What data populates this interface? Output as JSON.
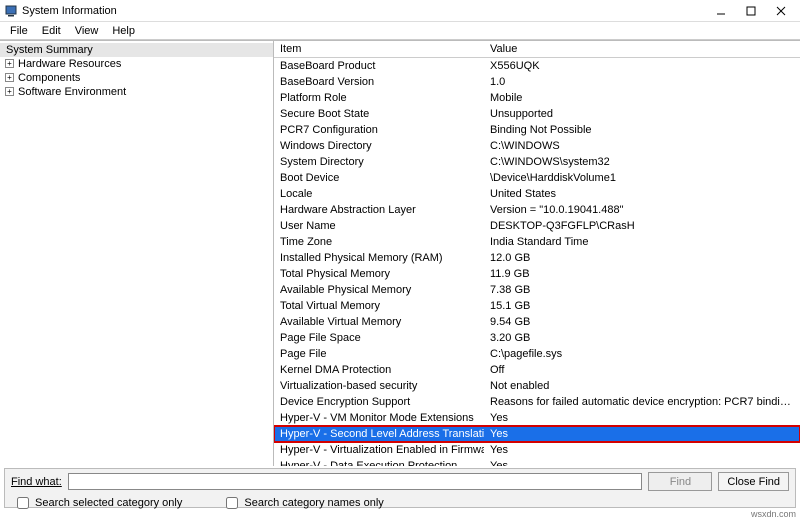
{
  "window": {
    "title": "System Information",
    "menu": [
      "File",
      "Edit",
      "View",
      "Help"
    ]
  },
  "tree": {
    "root": "System Summary",
    "children": [
      "Hardware Resources",
      "Components",
      "Software Environment"
    ]
  },
  "list": {
    "headers": {
      "item": "Item",
      "value": "Value"
    },
    "rows": [
      {
        "item": "BaseBoard Product",
        "value": "X556UQK"
      },
      {
        "item": "BaseBoard Version",
        "value": "1.0"
      },
      {
        "item": "Platform Role",
        "value": "Mobile"
      },
      {
        "item": "Secure Boot State",
        "value": "Unsupported"
      },
      {
        "item": "PCR7 Configuration",
        "value": "Binding Not Possible"
      },
      {
        "item": "Windows Directory",
        "value": "C:\\WINDOWS"
      },
      {
        "item": "System Directory",
        "value": "C:\\WINDOWS\\system32"
      },
      {
        "item": "Boot Device",
        "value": "\\Device\\HarddiskVolume1"
      },
      {
        "item": "Locale",
        "value": "United States"
      },
      {
        "item": "Hardware Abstraction Layer",
        "value": "Version = \"10.0.19041.488\""
      },
      {
        "item": "User Name",
        "value": "DESKTOP-Q3FGFLP\\CRasH"
      },
      {
        "item": "Time Zone",
        "value": "India Standard Time"
      },
      {
        "item": "Installed Physical Memory (RAM)",
        "value": "12.0 GB"
      },
      {
        "item": "Total Physical Memory",
        "value": "11.9 GB"
      },
      {
        "item": "Available Physical Memory",
        "value": "7.38 GB"
      },
      {
        "item": "Total Virtual Memory",
        "value": "15.1 GB"
      },
      {
        "item": "Available Virtual Memory",
        "value": "9.54 GB"
      },
      {
        "item": "Page File Space",
        "value": "3.20 GB"
      },
      {
        "item": "Page File",
        "value": "C:\\pagefile.sys"
      },
      {
        "item": "Kernel DMA Protection",
        "value": "Off"
      },
      {
        "item": "Virtualization-based security",
        "value": "Not enabled"
      },
      {
        "item": "Device Encryption Support",
        "value": "Reasons for failed automatic device encryption: PCR7 bindi…"
      },
      {
        "item": "Hyper-V - VM Monitor Mode Extensions",
        "value": "Yes"
      },
      {
        "item": "Hyper-V - Second Level Address Translation …",
        "value": "Yes",
        "selected": true,
        "highlighted": true
      },
      {
        "item": "Hyper-V - Virtualization Enabled in Firmware",
        "value": "Yes"
      },
      {
        "item": "Hyper-V - Data Execution Protection",
        "value": "Yes"
      }
    ]
  },
  "find": {
    "label_pre": "Find ",
    "label_u": "w",
    "label_post": "hat:",
    "value": "",
    "find_btn": "Find",
    "close_btn": "Close Find",
    "chk_selected": "Search selected category only",
    "chk_names": "Search category names only"
  },
  "watermark": "wsxdn.com"
}
